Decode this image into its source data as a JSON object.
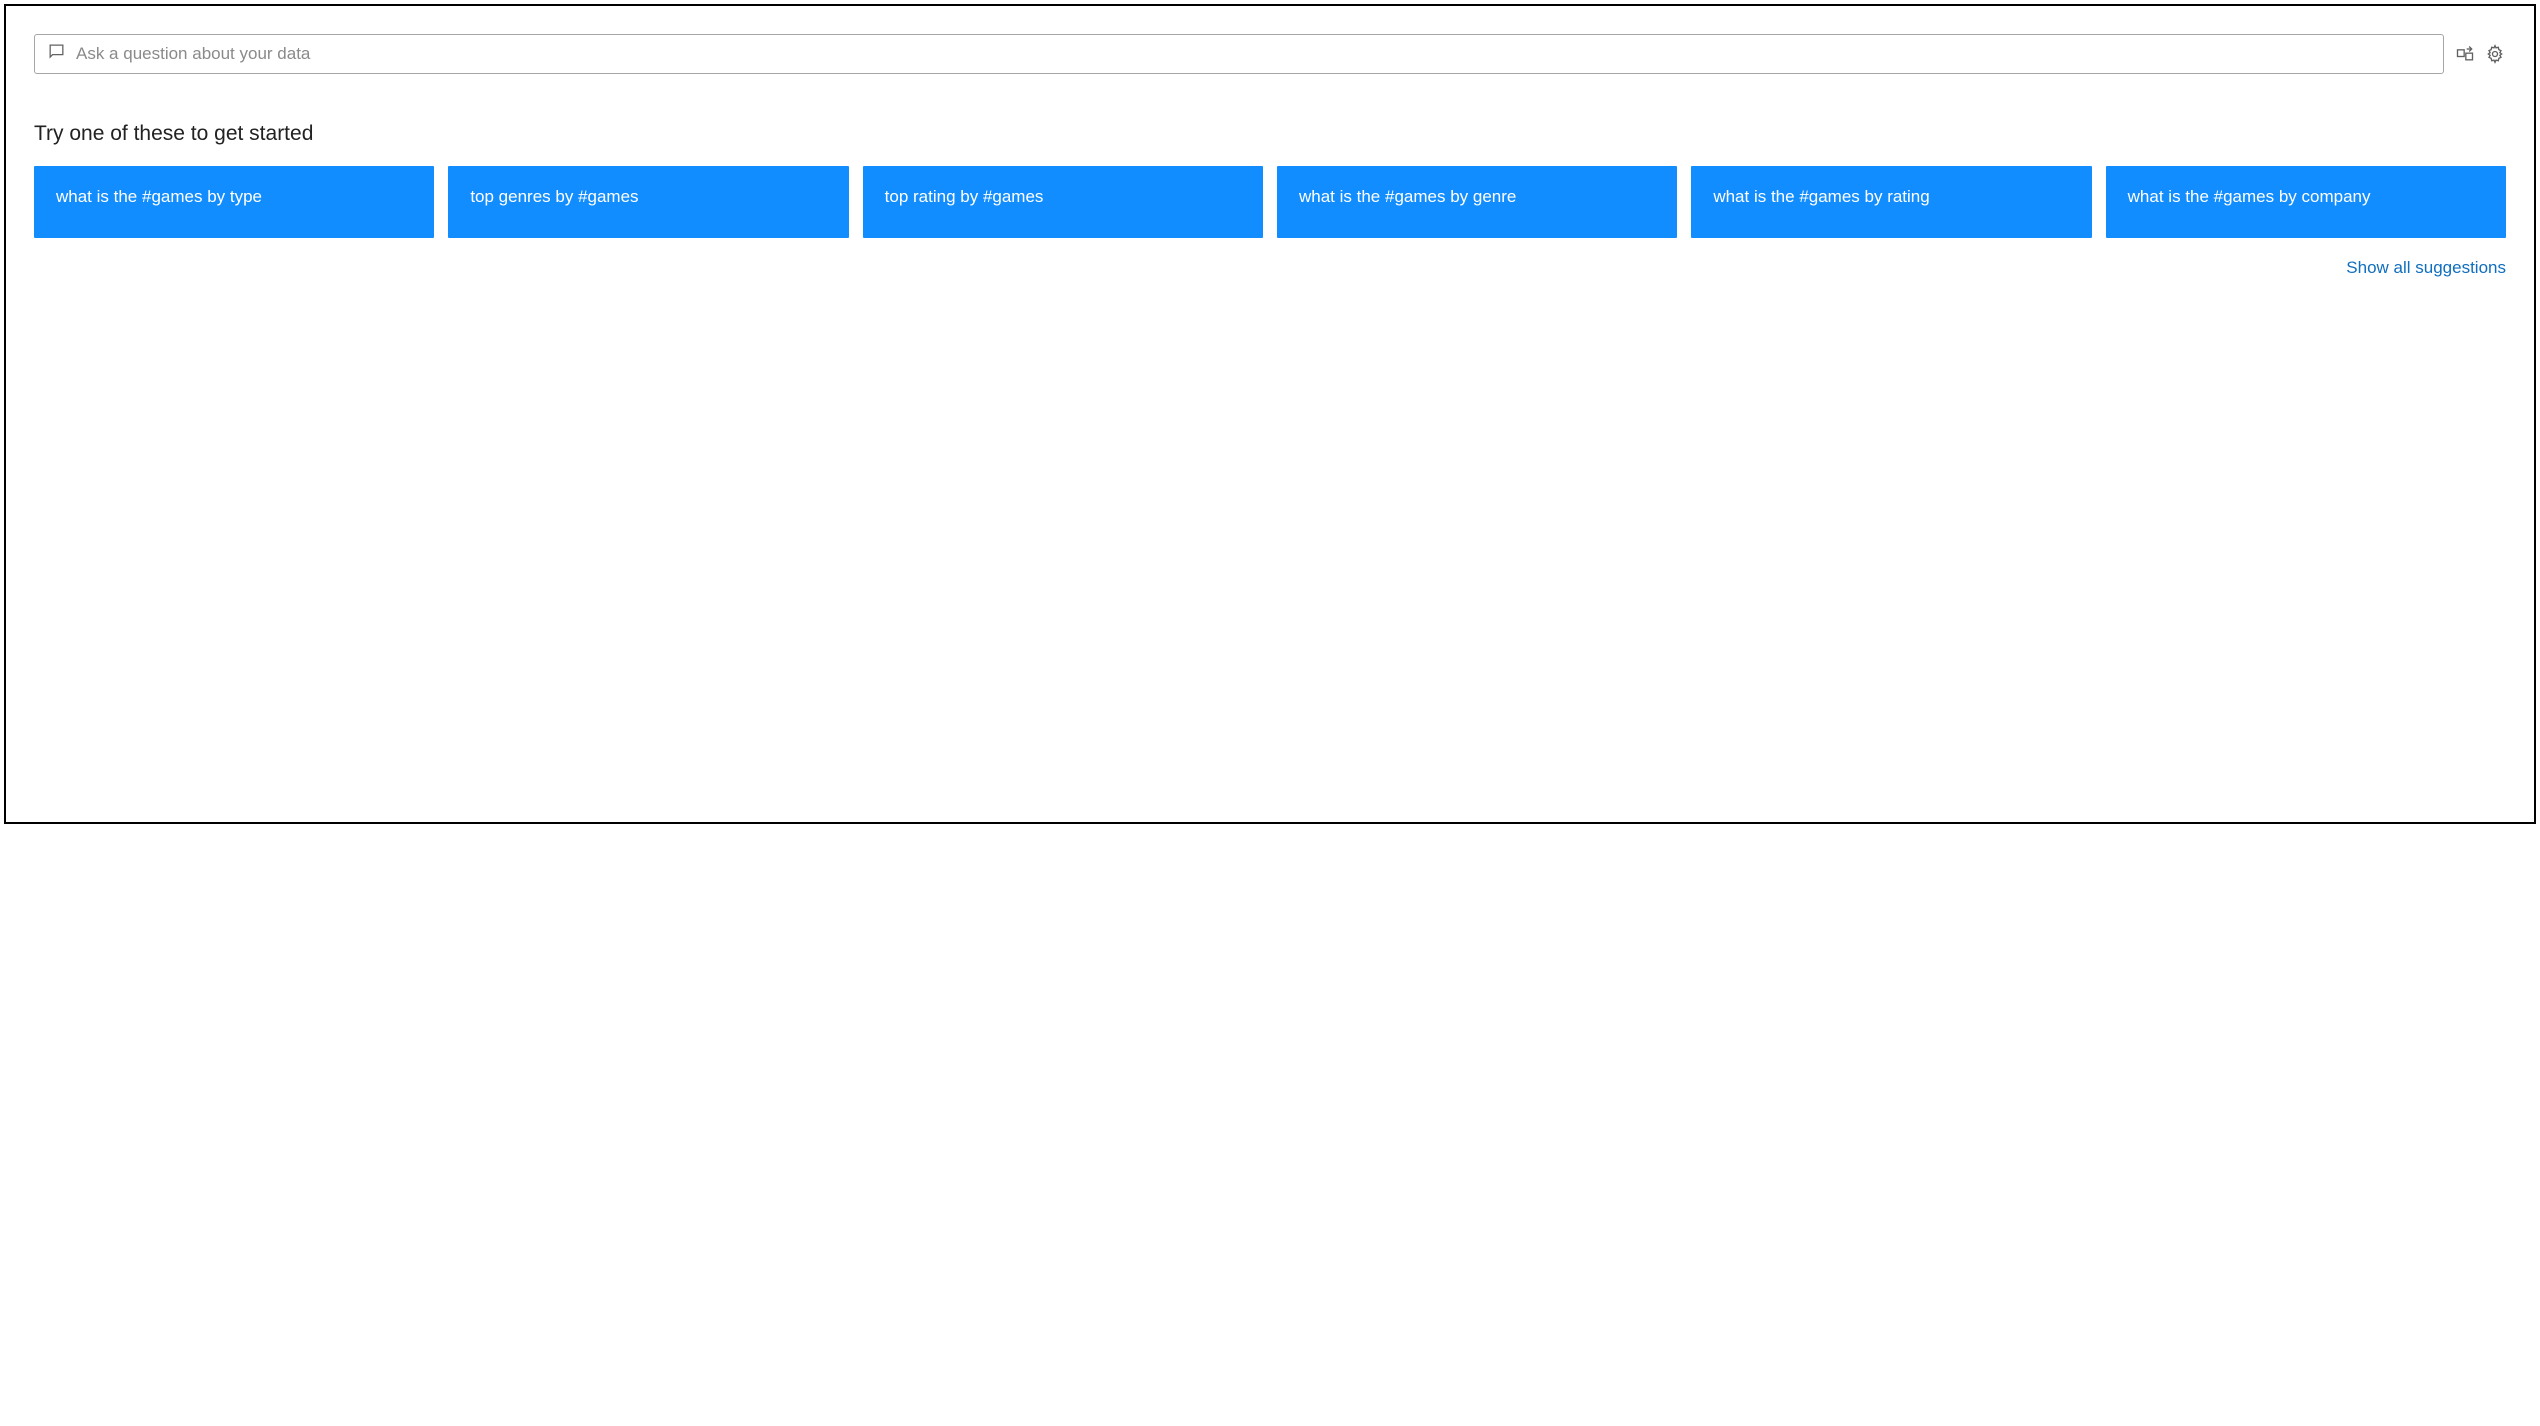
{
  "search": {
    "placeholder": "Ask a question about your data"
  },
  "heading": "Try one of these to get started",
  "suggestions": [
    "what is the #games by type",
    "top genres by #games",
    "top rating by #games",
    "what is the #games by genre",
    "what is the #games by rating",
    "what is the #games by company"
  ],
  "show_all_label": "Show all suggestions",
  "colors": {
    "card_bg": "#118dff",
    "link": "#106ebe"
  }
}
